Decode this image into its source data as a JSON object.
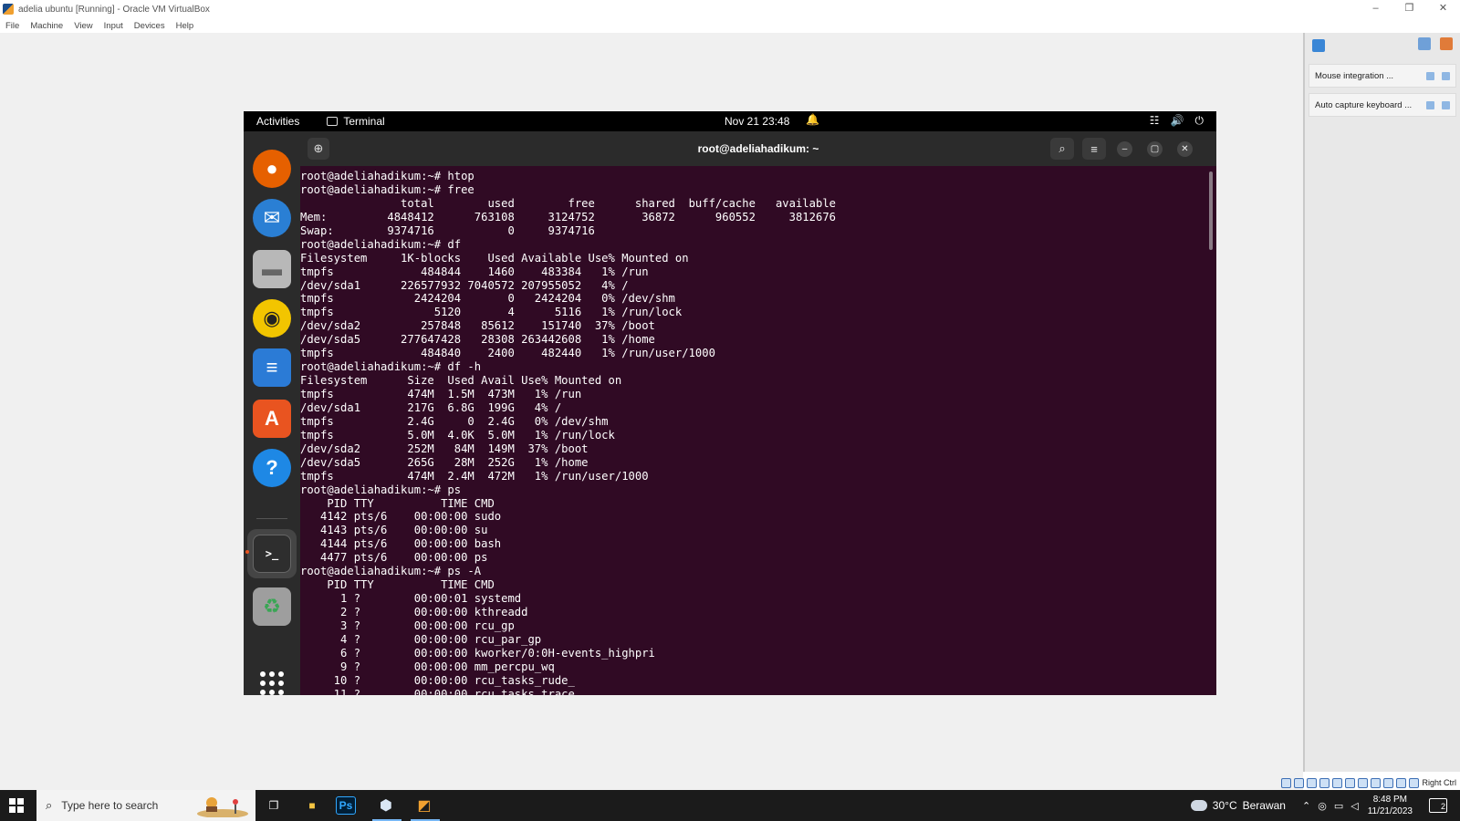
{
  "vbox": {
    "window_title": "adelia ubuntu [Running] - Oracle VM VirtualBox",
    "window_controls": [
      "–",
      "❐",
      "✕"
    ],
    "menu": [
      "File",
      "Machine",
      "View",
      "Input",
      "Devices",
      "Help"
    ],
    "notifications": [
      {
        "label": "Mouse integration ..."
      },
      {
        "label": "Auto capture keyboard ..."
      }
    ],
    "host_key": "Right Ctrl"
  },
  "gnome": {
    "activities": "Activities",
    "app_name": "Terminal",
    "clock": "Nov 21  23:48",
    "bell": "🔔",
    "sys_network": "☷",
    "sys_volume": "🔊",
    "sys_power": "⏻"
  },
  "dock": {
    "items": [
      {
        "name": "firefox",
        "glyph": "●",
        "color": "#e66000"
      },
      {
        "name": "thunderbird",
        "glyph": "✉",
        "color": "#2a7fd4"
      },
      {
        "name": "files",
        "glyph": "▬",
        "color": "#b8b8b8"
      },
      {
        "name": "rhythmbox",
        "glyph": "◉",
        "color": "#f2c500"
      },
      {
        "name": "writer",
        "glyph": "≡",
        "color": "#2b7bd6"
      },
      {
        "name": "app-center",
        "glyph": "A",
        "color": "#e95420"
      },
      {
        "name": "help",
        "glyph": "?",
        "color": "#1e88e5"
      },
      {
        "name": "terminal",
        "glyph": ">_",
        "color": "#2e2e2e"
      },
      {
        "name": "trash",
        "glyph": "♻",
        "color": "#9e9e9e"
      }
    ]
  },
  "terminal": {
    "title": "root@adeliahadikum: ~",
    "newtab": "⊕",
    "search": "⌕",
    "menu": "≡",
    "minimize": "–",
    "maximize": "▢",
    "close": "✕",
    "lines": [
      "root@adeliahadikum:~# htop",
      "root@adeliahadikum:~# free",
      "               total        used        free      shared  buff/cache   available",
      "Mem:         4848412      763108     3124752       36872      960552     3812676",
      "Swap:        9374716           0     9374716",
      "root@adeliahadikum:~# df",
      "Filesystem     1K-blocks    Used Available Use% Mounted on",
      "tmpfs             484844    1460    483384   1% /run",
      "/dev/sda1      226577932 7040572 207955052   4% /",
      "tmpfs            2424204       0   2424204   0% /dev/shm",
      "tmpfs               5120       4      5116   1% /run/lock",
      "/dev/sda2         257848   85612    151740  37% /boot",
      "/dev/sda5      277647428   28308 263442608   1% /home",
      "tmpfs             484840    2400    482440   1% /run/user/1000",
      "root@adeliahadikum:~# df -h",
      "Filesystem      Size  Used Avail Use% Mounted on",
      "tmpfs           474M  1.5M  473M   1% /run",
      "/dev/sda1       217G  6.8G  199G   4% /",
      "tmpfs           2.4G     0  2.4G   0% /dev/shm",
      "tmpfs           5.0M  4.0K  5.0M   1% /run/lock",
      "/dev/sda2       252M   84M  149M  37% /boot",
      "/dev/sda5       265G   28M  252G   1% /home",
      "tmpfs           474M  2.4M  472M   1% /run/user/1000",
      "root@adeliahadikum:~# ps",
      "    PID TTY          TIME CMD",
      "   4142 pts/6    00:00:00 sudo",
      "   4143 pts/6    00:00:00 su",
      "   4144 pts/6    00:00:00 bash",
      "   4477 pts/6    00:00:00 ps",
      "root@adeliahadikum:~# ps -A",
      "    PID TTY          TIME CMD",
      "      1 ?        00:00:01 systemd",
      "      2 ?        00:00:00 kthreadd",
      "      3 ?        00:00:00 rcu_gp",
      "      4 ?        00:00:00 rcu_par_gp",
      "      6 ?        00:00:00 kworker/0:0H-events_highpri",
      "      9 ?        00:00:00 mm_percpu_wq",
      "     10 ?        00:00:00 rcu_tasks_rude_",
      "     11 ?        00:00:00 rcu_tasks_trace"
    ]
  },
  "taskbar": {
    "search_placeholder": "Type here to search",
    "apps": [
      {
        "name": "task-view",
        "glyph": "❐",
        "color": "#ffffff"
      },
      {
        "name": "file-explorer",
        "glyph": "■",
        "color": "#f5c542"
      },
      {
        "name": "photoshop",
        "glyph": "Ps",
        "color": "#31a8ff"
      },
      {
        "name": "virtualbox",
        "glyph": "⬢",
        "color": "#d9e6f5"
      },
      {
        "name": "virtualbox-vm",
        "glyph": "◩",
        "color": "#f0a030"
      }
    ],
    "weather_temp": "30°C",
    "weather_desc": "Berawan",
    "time": "8:48 PM",
    "date": "11/21/2023",
    "notification_count": "2"
  }
}
